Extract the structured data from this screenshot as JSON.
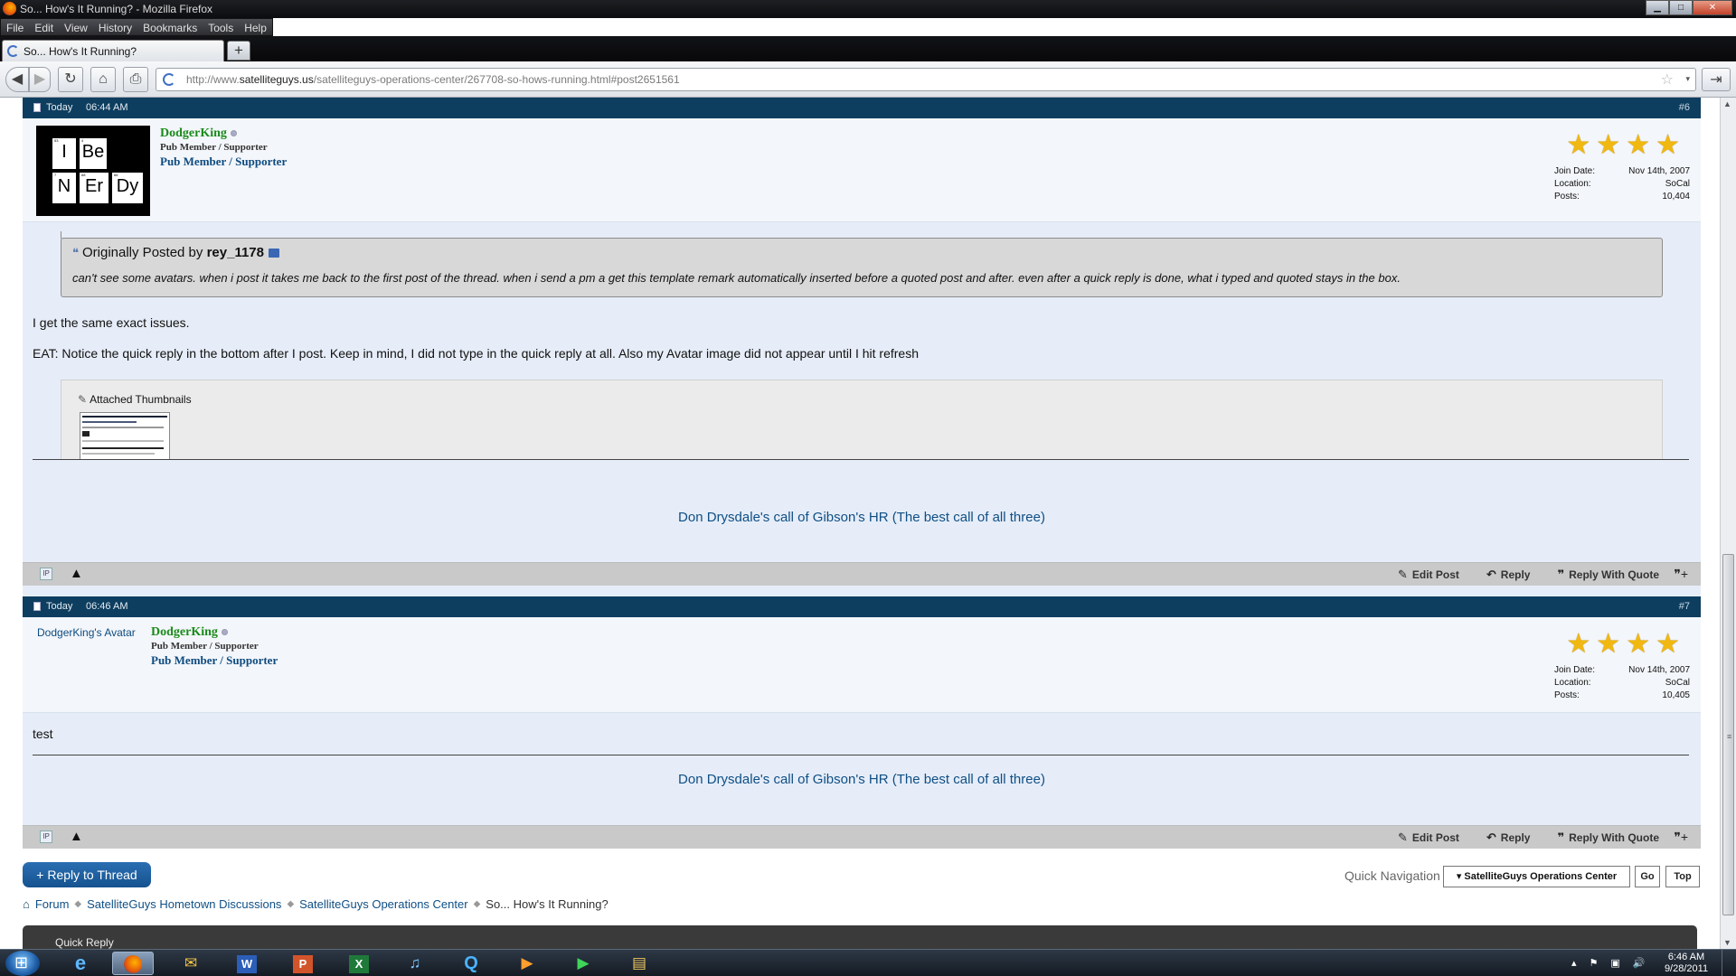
{
  "window": {
    "title": "So... How's It Running? - Mozilla Firefox",
    "controls": {
      "minimize": "▁",
      "maximize": "□",
      "close": "✕"
    }
  },
  "menu": [
    "File",
    "Edit",
    "View",
    "History",
    "Bookmarks",
    "Tools",
    "Help"
  ],
  "tab": {
    "label": "So... How's It Running?",
    "new_tab": "+"
  },
  "nav": {
    "back": "◀",
    "forward": "▶",
    "reload": "↻",
    "home": "⌂",
    "print": "⎙",
    "url_prefix": "http://www.",
    "url_domain": "satelliteguys.us",
    "url_rest": "/satelliteguys-operations-center/267708-so-hows-running.html#post2651561",
    "star": "☆",
    "dropdown": "▾",
    "end_button": "⇥"
  },
  "posts": [
    {
      "date": "Today",
      "time": "06:44 AM",
      "number": "#6",
      "avatar_tiles": [
        "I",
        "Be",
        "N",
        "Er",
        "Dy"
      ],
      "username": "DodgerKing",
      "title": "Pub Member / Supporter",
      "rank": "Pub Member / Supporter",
      "join_label": "Join Date:",
      "join_value": "Nov 14th, 2007",
      "location_label": "Location:",
      "location_value": "SoCal",
      "posts_label": "Posts:",
      "posts_value": "10,404",
      "quote_prefix": "Originally Posted by",
      "quote_author": "rey_1178",
      "quote_text": "can't see some avatars. when i post it takes me back to the first post of the thread. when i send a pm a get this template remark automatically inserted before a quoted post and after. even after a quick reply is done, what i typed and quoted stays in the box.",
      "body_1": "I get the same exact issues.",
      "body_2": "EAT: Notice the quick reply in the bottom after I post. Keep in mind, I did not type in the quick reply at all. Also my Avatar image did not appear until I hit refresh",
      "attachments_label": "Attached Thumbnails",
      "signature": "Don Drysdale's call of Gibson's HR (The best call of all three)"
    },
    {
      "date": "Today",
      "time": "06:46 AM",
      "number": "#7",
      "avatar_alt": "DodgerKing's Avatar",
      "username": "DodgerKing",
      "title": "Pub Member / Supporter",
      "rank": "Pub Member / Supporter",
      "join_label": "Join Date:",
      "join_value": "Nov 14th, 2007",
      "location_label": "Location:",
      "location_value": "SoCal",
      "posts_label": "Posts:",
      "posts_value": "10,405",
      "body_1": "test",
      "signature": "Don Drysdale's call of Gibson's HR (The best call of all three)"
    }
  ],
  "post_actions": {
    "edit": "Edit Post",
    "reply": "Reply",
    "reply_quote": "Reply With Quote"
  },
  "reply_to_thread": "+ Reply to Thread",
  "quick_nav": {
    "label": "Quick Navigation",
    "selected": "▾ SatelliteGuys Operations Center",
    "go": "Go",
    "top": "Top"
  },
  "breadcrumbs": [
    "Forum",
    "SatelliteGuys Hometown Discussions",
    "SatelliteGuys Operations Center",
    "So... How's It Running?"
  ],
  "quick_reply_label": "Quick Reply",
  "taskbar": {
    "time": "6:46 AM",
    "date": "9/28/2011"
  }
}
